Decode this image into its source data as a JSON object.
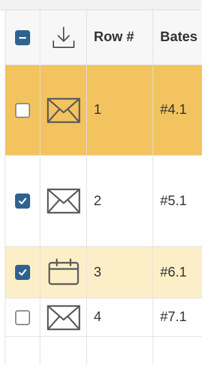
{
  "columns": {
    "select_all_icon": "indeterminate-checkbox",
    "download_icon": "download-icon",
    "row_number": "Row #",
    "bates": "Bates"
  },
  "rows": [
    {
      "row_number": "1",
      "bates": "#4.1",
      "checked": false,
      "type_icon": "envelope-icon",
      "highlight": "selected"
    },
    {
      "row_number": "2",
      "bates": "#5.1",
      "checked": true,
      "type_icon": "envelope-icon",
      "highlight": "none"
    },
    {
      "row_number": "3",
      "bates": "#6.1",
      "checked": true,
      "type_icon": "calendar-icon",
      "highlight": "light"
    },
    {
      "row_number": "4",
      "bates": "#7.1",
      "checked": false,
      "type_icon": "envelope-icon",
      "highlight": "none"
    }
  ],
  "colors": {
    "checkbox_checked": "#2e6390",
    "row_selected": "#f2c35e",
    "row_highlight_light": "#fcefc7",
    "icon_stroke": "#5a5a5a"
  }
}
